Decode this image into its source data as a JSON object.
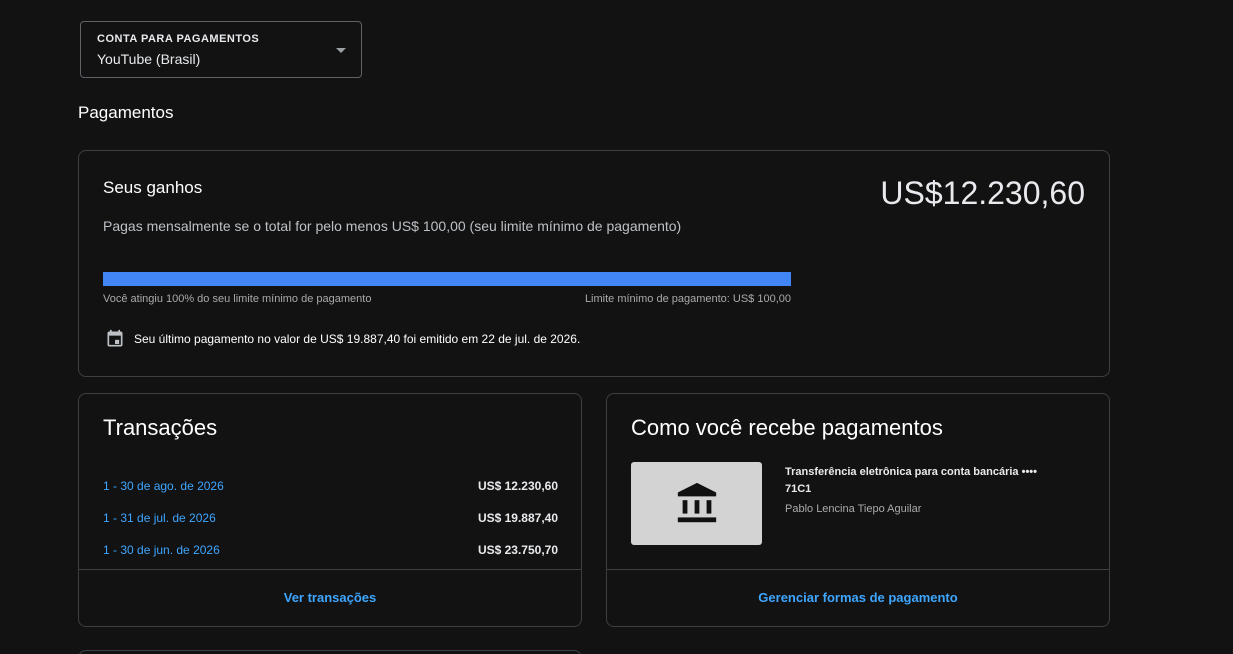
{
  "account_select": {
    "label": "CONTA PARA PAGAMENTOS",
    "value": "YouTube (Brasil)"
  },
  "section_title": "Pagamentos",
  "earnings": {
    "title": "Seus ganhos",
    "amount": "US$12.230,60",
    "description": "Pagas mensalmente se o total for pelo menos US$ 100,00 (seu limite mínimo de pagamento)",
    "progress_percent": 100,
    "progress_left_text": "Você atingiu 100% do seu limite mínimo de pagamento",
    "progress_right_text": "Limite mínimo de pagamento: US$ 100,00",
    "last_payment_text": "Seu último pagamento no valor de US$ 19.887,40 foi emitido em 22 de jul. de 2026.",
    "colors": {
      "progress_fill": "#4285f4"
    }
  },
  "transactions": {
    "title": "Transações",
    "rows": [
      {
        "period": "1 - 30 de ago. de 2026",
        "amount": "US$ 12.230,60"
      },
      {
        "period": "1 - 31 de jul. de 2026",
        "amount": "US$ 19.887,40"
      },
      {
        "period": "1 - 30 de jun. de 2026",
        "amount": "US$ 23.750,70"
      }
    ],
    "action_label": "Ver transações"
  },
  "payment_method": {
    "title": "Como você recebe pagamentos",
    "method_name": "Transferência eletrônica para conta bancária •••• 71C1",
    "owner": "Pablo Lencina Tiepo Aguilar",
    "icon": "bank-icon",
    "action_label": "Gerenciar formas de pagamento"
  },
  "icons": {
    "calendar": "calendar-icon",
    "dropdown": "chevron-down-icon"
  }
}
